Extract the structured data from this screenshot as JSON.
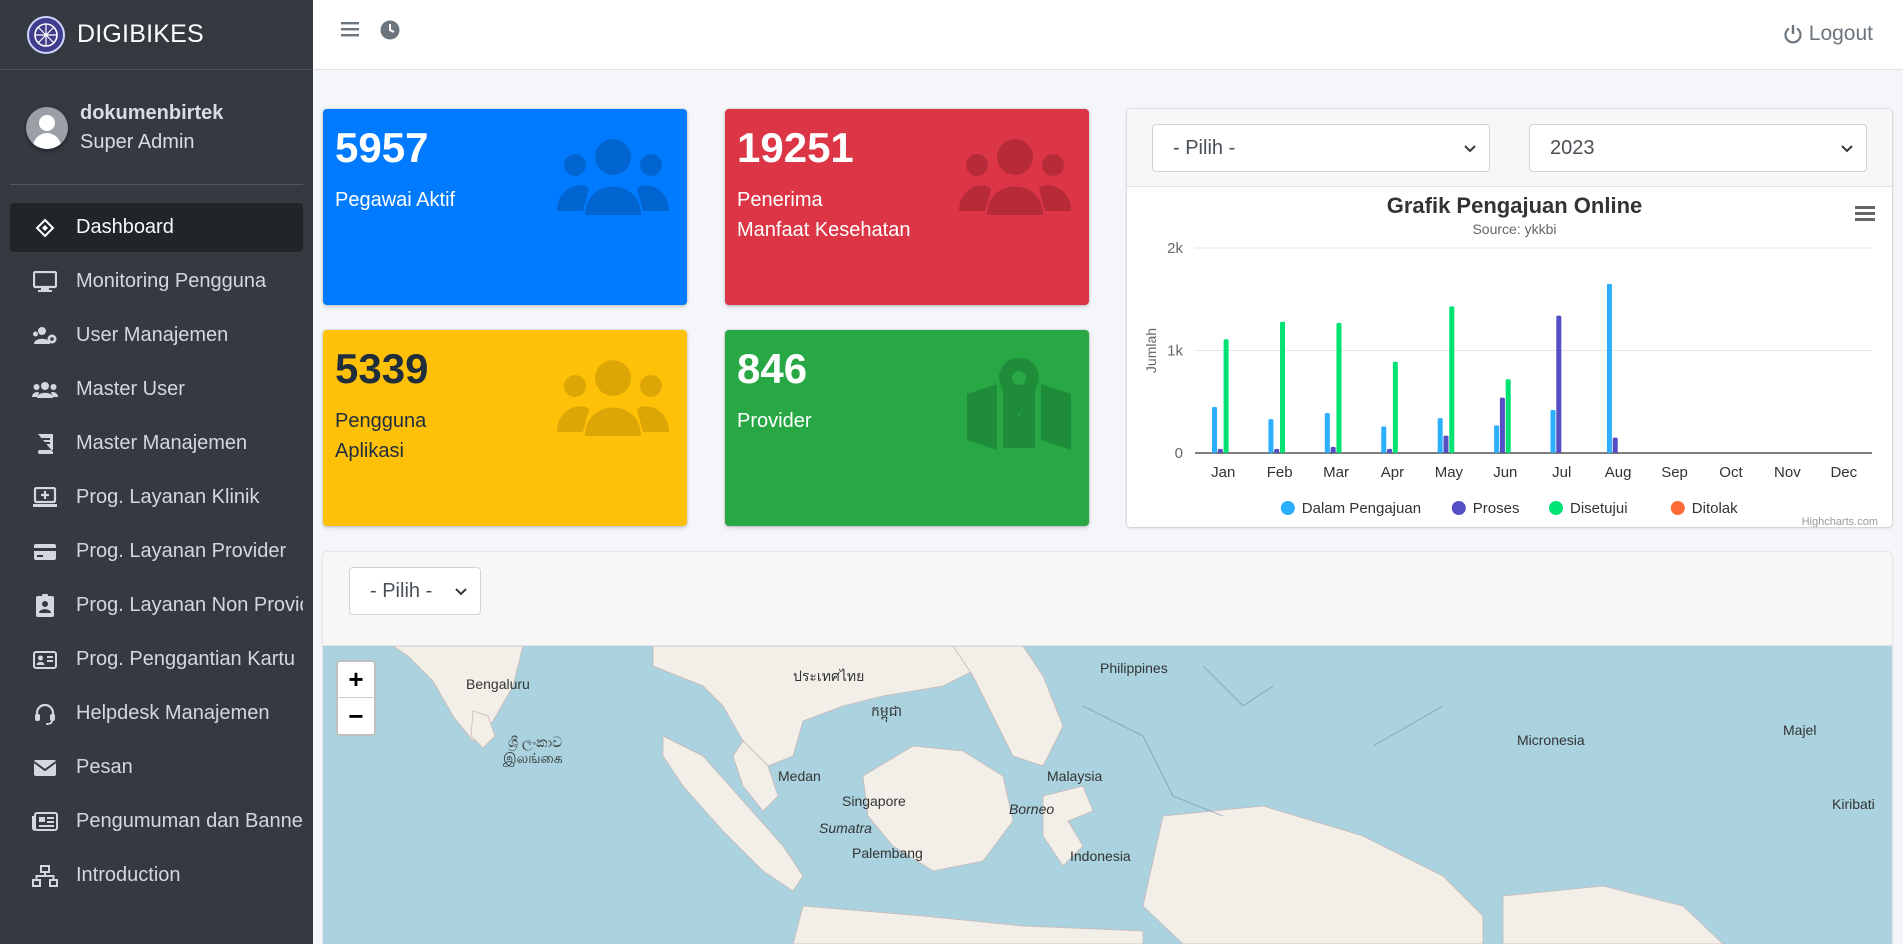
{
  "brand": {
    "name": "DIGIBIKES"
  },
  "user": {
    "name": "dokumenbirtek",
    "role": "Super Admin"
  },
  "sidebar": {
    "items": [
      {
        "label": "Dashboard",
        "icon": "dashboard-icon",
        "active": true
      },
      {
        "label": "Monitoring Pengguna",
        "icon": "desktop-icon"
      },
      {
        "label": "User Manajemen",
        "icon": "users-cog-icon"
      },
      {
        "label": "Master User",
        "icon": "users-icon"
      },
      {
        "label": "Master Manajemen",
        "icon": "book-icon"
      },
      {
        "label": "Prog. Layanan Klinik",
        "icon": "clinic-icon"
      },
      {
        "label": "Prog. Layanan Provider",
        "icon": "credit-card-icon"
      },
      {
        "label": "Prog. Layanan Non Provider",
        "icon": "id-badge-icon"
      },
      {
        "label": "Prog. Penggantian Kartu",
        "icon": "id-card-icon"
      },
      {
        "label": "Helpdesk Manajemen",
        "icon": "headset-icon"
      },
      {
        "label": "Pesan",
        "icon": "envelope-icon"
      },
      {
        "label": "Pengumuman dan Banner",
        "icon": "newspaper-icon"
      },
      {
        "label": "Introduction",
        "icon": "sitemap-icon"
      }
    ]
  },
  "header": {
    "logout_label": "Logout"
  },
  "stats": {
    "pegawai": {
      "value": "5957",
      "label": "Pegawai Aktif",
      "color": "#007bff"
    },
    "penerima": {
      "value": "19251",
      "label_1": "Penerima",
      "label_2": "Manfaat Kesehatan",
      "color": "#dc3545"
    },
    "pengguna": {
      "value": "5339",
      "label_1": "Pengguna",
      "label_2": "Aplikasi",
      "color": "#ffc107"
    },
    "provider": {
      "value": "846",
      "label": "Provider",
      "color": "#28a745"
    }
  },
  "filters": {
    "month_placeholder": "- Pilih -",
    "year_value": "2023",
    "map_placeholder": "- Pilih -"
  },
  "chart_data": {
    "type": "bar",
    "title": "Grafik Pengajuan Online",
    "subtitle": "Source: ykkbi",
    "ylabel": "Jumlah",
    "xlabel": "",
    "ylim": [
      0,
      2000
    ],
    "yticks": [
      0,
      1000,
      2000
    ],
    "ytick_labels": [
      "0",
      "1k",
      "2k"
    ],
    "categories": [
      "Jan",
      "Feb",
      "Mar",
      "Apr",
      "May",
      "Jun",
      "Jul",
      "Aug",
      "Sep",
      "Oct",
      "Nov",
      "Dec"
    ],
    "series": [
      {
        "name": "Dalam Pengajuan",
        "color": "#2caffe",
        "values": [
          450,
          330,
          390,
          260,
          340,
          270,
          420,
          1650,
          0,
          0,
          0,
          0
        ]
      },
      {
        "name": "Proses",
        "color": "#544fc5",
        "values": [
          40,
          40,
          60,
          40,
          170,
          540,
          1340,
          150,
          0,
          0,
          0,
          0
        ]
      },
      {
        "name": "Disetujui",
        "color": "#00e272",
        "values": [
          1110,
          1280,
          1270,
          890,
          1430,
          720,
          0,
          0,
          0,
          0,
          0,
          0
        ]
      },
      {
        "name": "Ditolak",
        "color": "#fe6a35",
        "values": [
          0,
          0,
          0,
          0,
          0,
          0,
          0,
          0,
          0,
          0,
          0,
          0
        ]
      }
    ],
    "legend_position": "bottom-center",
    "credits": "Highcharts.com",
    "grid": true
  },
  "map": {
    "labels": [
      {
        "text": "Bengaluru"
      },
      {
        "text": "ශ්‍රී ලංකාව"
      },
      {
        "text": "இலங்கை"
      },
      {
        "text": "ประเทศไทย"
      },
      {
        "text": "កម្ពុជា"
      },
      {
        "text": "Philippines"
      },
      {
        "text": "Medan"
      },
      {
        "text": "Malaysia"
      },
      {
        "text": "Singapore"
      },
      {
        "text": "Borneo",
        "italic": true
      },
      {
        "text": "Sumatra",
        "italic": true
      },
      {
        "text": "Palembang"
      },
      {
        "text": "Indonesia"
      },
      {
        "text": "Micronesia"
      },
      {
        "text": "Majel"
      },
      {
        "text": "Kiribati"
      }
    ]
  }
}
